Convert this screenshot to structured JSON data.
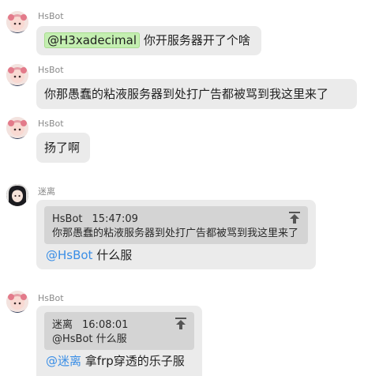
{
  "messages": [
    {
      "sender": "HsBot",
      "mention": "@H3xadecimal",
      "text": "你开服务器开了个啥"
    },
    {
      "sender": "HsBot",
      "text": "你那愚蠢的粘液服务器到处打广告都被骂到我这里来了"
    },
    {
      "sender": "HsBot",
      "text": "扬了啊"
    },
    {
      "sender": "迷离",
      "quote": {
        "author": "HsBot",
        "time": "15:47:09",
        "text": "你那愚蠢的粘液服务器到处打广告都被骂到我这里来了",
        "icon": "jump-to-top-icon"
      },
      "mention": "@HsBot",
      "text": "什么服"
    },
    {
      "sender": "HsBot",
      "quote": {
        "author": "迷离",
        "time": "16:08:01",
        "text": "@HsBot 什么服",
        "icon": "jump-to-top-icon"
      },
      "mention": "@迷离",
      "text": "拿frp穿透的乐子服"
    }
  ],
  "colors": {
    "bubble": "#ebebeb",
    "quote_bg": "#d4d4d4",
    "mention_link": "#3a8ee6",
    "mention_highlight": "#c4efb1"
  }
}
